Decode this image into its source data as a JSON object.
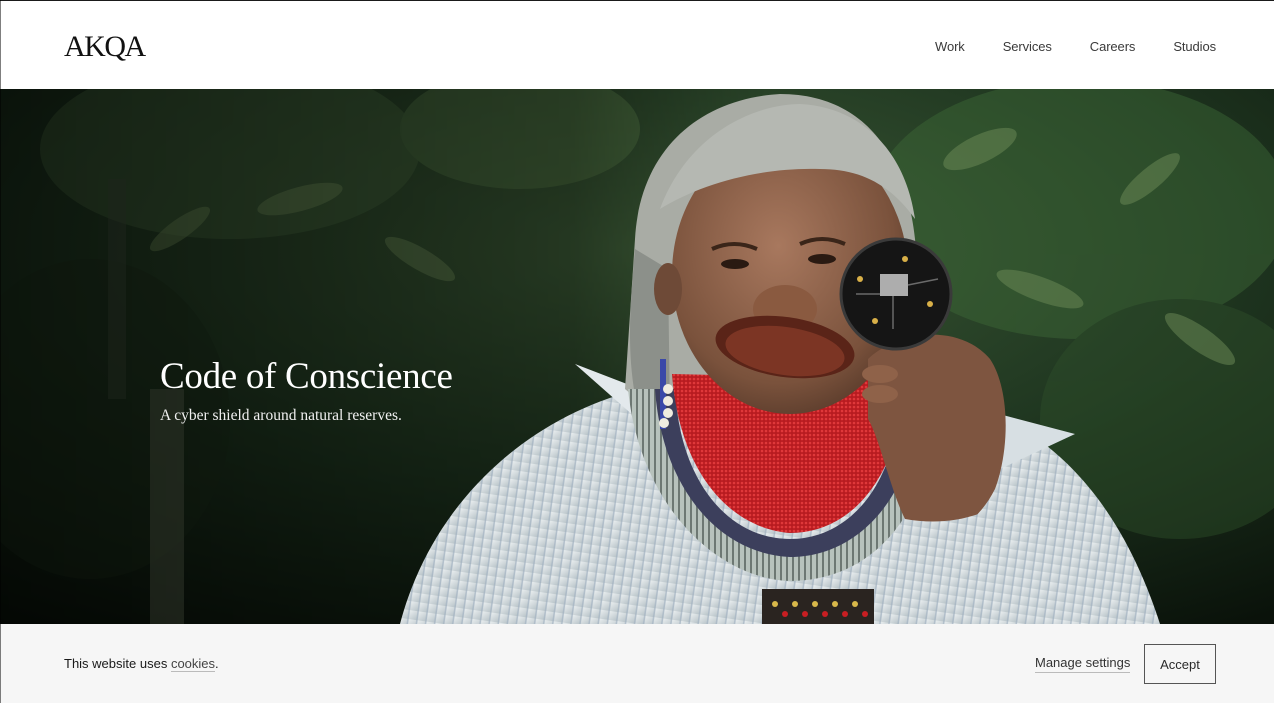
{
  "header": {
    "logo": "AKQA",
    "nav": [
      "Work",
      "Services",
      "Careers",
      "Studios"
    ]
  },
  "hero": {
    "title": "Code of Conscience",
    "subtitle": "A cyber shield around natural reserves."
  },
  "cookie_bar": {
    "text_prefix": "This website uses ",
    "link": "cookies",
    "text_suffix": ".",
    "manage_label": "Manage settings",
    "accept_label": "Accept"
  },
  "colors": {
    "foliage_dark": "#0f1a10",
    "foliage_mid": "#2e4a2b",
    "beads_red": "#c81e22",
    "shirt": "#dfe6ea",
    "cookie_bg": "#f6f6f6"
  }
}
